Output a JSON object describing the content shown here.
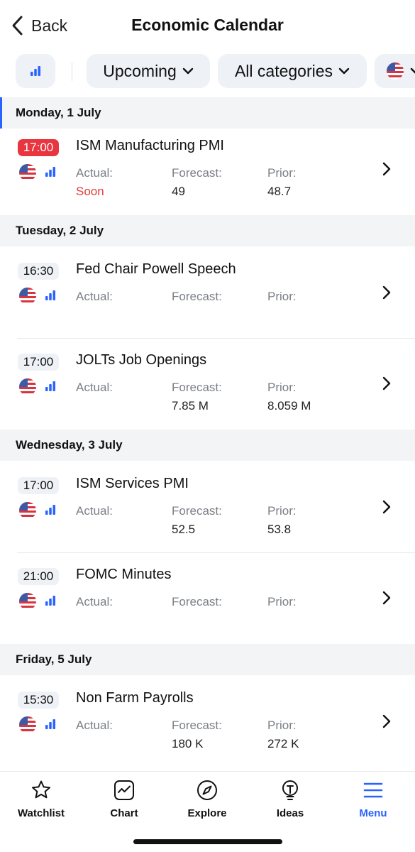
{
  "header": {
    "back_label": "Back",
    "title": "Economic Calendar"
  },
  "filters": {
    "period": "Upcoming",
    "categories": "All categories",
    "importance_icon": "signal-bars-icon",
    "country_icon": "us-flag-icon"
  },
  "colors": {
    "accent": "#2962ff",
    "live_time": "#e8353f",
    "soon": "#e23c3c"
  },
  "days": [
    {
      "date": "Monday, 1 July",
      "events": [
        {
          "time": "17:00",
          "live": true,
          "name": "ISM Manufacturing PMI",
          "actual_label": "Actual:",
          "actual": "Soon",
          "forecast_label": "Forecast:",
          "forecast": "49",
          "prior_label": "Prior:",
          "prior": "48.7"
        }
      ]
    },
    {
      "date": "Tuesday, 2 July",
      "events": [
        {
          "time": "16:30",
          "live": false,
          "name": "Fed Chair Powell Speech",
          "actual_label": "Actual:",
          "actual": "",
          "forecast_label": "Forecast:",
          "forecast": "",
          "prior_label": "Prior:",
          "prior": ""
        },
        {
          "time": "17:00",
          "live": false,
          "name": "JOLTs Job Openings",
          "actual_label": "Actual:",
          "actual": "",
          "forecast_label": "Forecast:",
          "forecast": "7.85 M",
          "prior_label": "Prior:",
          "prior": "8.059 M"
        }
      ]
    },
    {
      "date": "Wednesday, 3 July",
      "events": [
        {
          "time": "17:00",
          "live": false,
          "name": "ISM Services PMI",
          "actual_label": "Actual:",
          "actual": "",
          "forecast_label": "Forecast:",
          "forecast": "52.5",
          "prior_label": "Prior:",
          "prior": "53.8"
        },
        {
          "time": "21:00",
          "live": false,
          "name": "FOMC Minutes",
          "actual_label": "Actual:",
          "actual": "",
          "forecast_label": "Forecast:",
          "forecast": "",
          "prior_label": "Prior:",
          "prior": ""
        }
      ]
    },
    {
      "date": "Friday, 5 July",
      "events": [
        {
          "time": "15:30",
          "live": false,
          "name": "Non Farm Payrolls",
          "actual_label": "Actual:",
          "actual": "",
          "forecast_label": "Forecast:",
          "forecast": "180 K",
          "prior_label": "Prior:",
          "prior": "272 K"
        }
      ]
    }
  ],
  "bottom_nav": [
    {
      "label": "Watchlist",
      "icon": "star-icon",
      "active": false
    },
    {
      "label": "Chart",
      "icon": "chart-icon",
      "active": false
    },
    {
      "label": "Explore",
      "icon": "compass-icon",
      "active": false
    },
    {
      "label": "Ideas",
      "icon": "lightbulb-icon",
      "active": false
    },
    {
      "label": "Menu",
      "icon": "menu-icon",
      "active": true
    }
  ]
}
